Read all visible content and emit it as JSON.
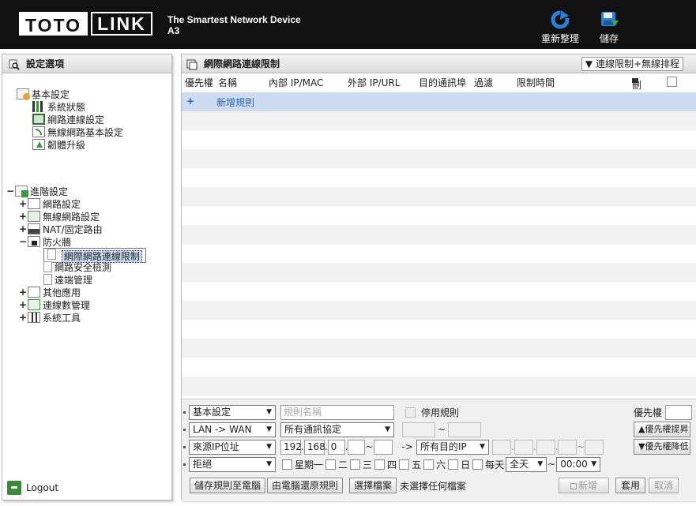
{
  "header": {
    "logo_left": "TOTO",
    "logo_right": "LINK",
    "tagline": "The Smartest Network Device",
    "model": "A3",
    "refresh_label": "重新整理",
    "save_label": "儲存"
  },
  "sidebar": {
    "title": "設定選項",
    "basic": {
      "label": "基本設定",
      "items": [
        "系統狀態",
        "網路連線設定",
        "無線網路基本設定",
        "韌體升級"
      ]
    },
    "advanced": {
      "toggle": "−",
      "label": "進階設定",
      "items": [
        {
          "toggle": "+",
          "label": "網路設定"
        },
        {
          "toggle": "+",
          "label": "無線網路設定"
        },
        {
          "toggle": "+",
          "label": "NAT/固定路由"
        },
        {
          "toggle": "−",
          "label": "防火牆"
        },
        {
          "toggle": "+",
          "label": "其他應用"
        },
        {
          "toggle": "+",
          "label": "連線數管理"
        },
        {
          "toggle": "+",
          "label": "系統工具"
        }
      ],
      "firewall_items": [
        "網際網路連線限制",
        "網路安全檢測",
        "遠端管理"
      ]
    },
    "logout": "Logout"
  },
  "main": {
    "title": "網際網路連線限制",
    "view_select": "連線限制+無線排程",
    "columns": {
      "priority": "優先權",
      "name": "名稱",
      "internal": "內部 IP/MAC",
      "external": "外部 IP/URL",
      "port": "目的通訊埠",
      "filter": "過濾",
      "time": "限制時間",
      "delete": "刪除"
    },
    "add_rule": "新增規則",
    "plus": "+"
  },
  "form": {
    "mode": "基本設定",
    "name_placeholder": "規則名稱",
    "disable_rule": "停用規則",
    "direction": "LAN -> WAN",
    "protocol": "所有通訊協定",
    "tilde": "~",
    "source": "來源IP位址",
    "ip": [
      "192",
      "168",
      "0",
      ""
    ],
    "arrow": "->",
    "dest": "所有目的IP",
    "action": "拒絕",
    "days": [
      "星期一",
      "二",
      "三",
      "四",
      "五",
      "六",
      "日"
    ],
    "everyday": "每天",
    "allday": "全天",
    "time": "00:00",
    "priority_label": "優先權",
    "raise": "優先權提昇",
    "lower": "優先權降低",
    "save_to_pc": "儲存規則至電腦",
    "restore_from_pc": "由電腦還原規則",
    "choose_file": "選擇檔案",
    "no_file": "未選擇任何檔案",
    "add": "新增",
    "apply": "套用",
    "cancel": "取消"
  }
}
